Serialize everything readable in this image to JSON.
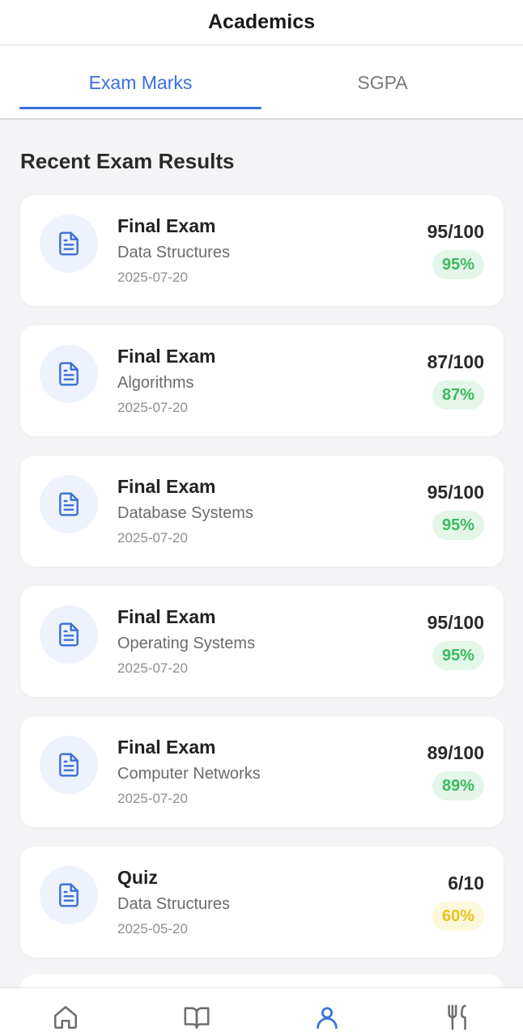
{
  "header": {
    "title": "Academics"
  },
  "tabs": [
    {
      "label": "Exam Marks",
      "active": true
    },
    {
      "label": "SGPA",
      "active": false
    }
  ],
  "section": {
    "title": "Recent Exam Results"
  },
  "results": [
    {
      "type": "Final Exam",
      "subject": "Data Structures",
      "date": "2025-07-20",
      "score": "95/100",
      "percent": "95%",
      "status": "green"
    },
    {
      "type": "Final Exam",
      "subject": "Algorithms",
      "date": "2025-07-20",
      "score": "87/100",
      "percent": "87%",
      "status": "green"
    },
    {
      "type": "Final Exam",
      "subject": "Database Systems",
      "date": "2025-07-20",
      "score": "95/100",
      "percent": "95%",
      "status": "green"
    },
    {
      "type": "Final Exam",
      "subject": "Operating Systems",
      "date": "2025-07-20",
      "score": "95/100",
      "percent": "95%",
      "status": "green"
    },
    {
      "type": "Final Exam",
      "subject": "Computer Networks",
      "date": "2025-07-20",
      "score": "89/100",
      "percent": "89%",
      "status": "green"
    },
    {
      "type": "Quiz",
      "subject": "Data Structures",
      "date": "2025-05-20",
      "score": "6/10",
      "percent": "60%",
      "status": "yellow"
    }
  ],
  "result_icon": "document-icon",
  "bottom_nav": [
    {
      "icon": "home-icon",
      "active": false
    },
    {
      "icon": "book-icon",
      "active": false
    },
    {
      "icon": "profile-icon",
      "active": true
    },
    {
      "icon": "dining-icon",
      "active": false
    }
  ],
  "colors": {
    "accent": "#3a6fd8",
    "success": "#3cba5f",
    "warning": "#e8c21a",
    "inactive_icon": "#6e6e6e"
  }
}
